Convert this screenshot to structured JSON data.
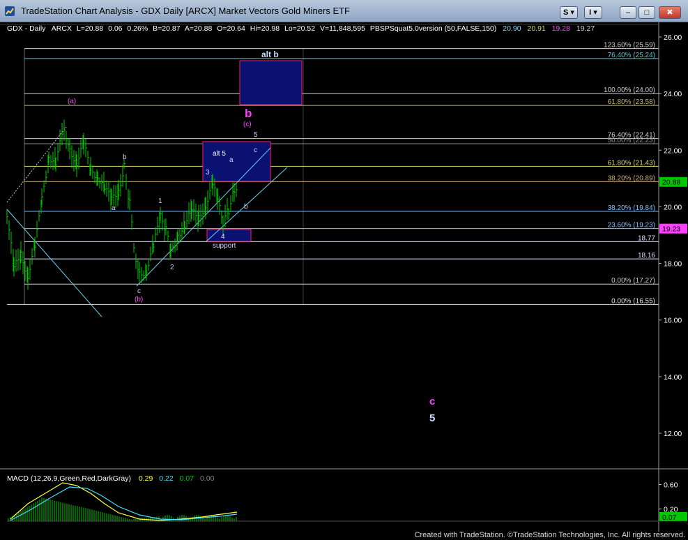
{
  "window": {
    "title": "TradeStation Chart Analysis - GDX Daily [ARCX] Market Vectors Gold Miners ETF",
    "btn_s": "S",
    "btn_i": "I",
    "btn_minimize": "–",
    "btn_restore": "□",
    "btn_close": "✖"
  },
  "status_line": {
    "symbol": "GDX - Daily",
    "exchange": "ARCX",
    "last": "L=20.88",
    "change": "0.06",
    "pct": "0.26%",
    "bid": "B=20.87",
    "ask": "A=20.88",
    "open": "O=20.64",
    "high": "Hi=20.98",
    "low": "Lo=20.52",
    "volume": "V=11,848,595",
    "study": "PBSPSquat5.0version (50,FALSE,150)",
    "v1": "20.90",
    "v2": "20.91",
    "v3": "19.28",
    "v4": "19.27"
  },
  "colors": {
    "study_v1": "#7fd7ff",
    "study_v2": "#d7d76c",
    "study_v3": "#ff40ff",
    "study_v4": "#d7d7d7",
    "price_bars": "#00c800",
    "box_fill": "#0a1170",
    "box_border": "#ff1a6b",
    "wave_magenta": "#ff40ff",
    "wave_white": "#c8c8ff",
    "channel_line": "#6ed0f0",
    "last_price_bg": "#00c800",
    "support_price_bg": "#ff40ff"
  },
  "price_axis": {
    "min": 11,
    "max": 26.5,
    "ticks": [
      "26.00",
      "24.00",
      "22.00",
      "20.00",
      "18.00",
      "16.00",
      "14.00",
      "12.00"
    ],
    "last_price": "20.88",
    "last_value": 20.88,
    "support_price": "19.23",
    "support_value": 19.23
  },
  "fib_levels": [
    {
      "label": "123.60% (25.59)",
      "value": 25.59,
      "color": "#d0d0d0"
    },
    {
      "label": "76.40% (25.24)",
      "value": 25.24,
      "color": "#56c8d0"
    },
    {
      "label": "100.00% (24.00)",
      "value": 24.0,
      "color": "#d0d0d0"
    },
    {
      "label": "61.80% (23.58)",
      "value": 23.58,
      "color": "#c8b070"
    },
    {
      "label": "76.40% (22.41)",
      "value": 22.41,
      "color": "#d0d0d0"
    },
    {
      "label": "50.00% (22.23)",
      "value": 22.23,
      "color": "#909090"
    },
    {
      "label": "61.80% (21.43)",
      "value": 21.43,
      "color": "#d7d76c"
    },
    {
      "label": "38.20% (20.89)",
      "value": 20.89,
      "color": "#c8b070"
    },
    {
      "label": "38.20% (19.84)",
      "value": 19.84,
      "color": "#7fc4ff"
    },
    {
      "label": "23.60% (19.23)",
      "value": 19.23,
      "color": "#7fc4ff"
    },
    {
      "label": "18.77",
      "value": 18.77,
      "color": "#e0e0ff"
    },
    {
      "label": "18.16",
      "value": 18.16,
      "color": "#e0e0ff"
    },
    {
      "label": "0.00% (17.27)",
      "value": 17.27,
      "color": "#d0d0d0"
    },
    {
      "label": "0.00% (16.55)",
      "value": 16.55,
      "color": "#e0e0e0"
    }
  ],
  "wave_labels": {
    "alt_b": "alt b",
    "b_big": "b",
    "c_paren": "(c)",
    "five_top": "5",
    "alt_five": "alt 5",
    "c_small": "c",
    "a_small": "a",
    "three": "3",
    "a_paren": "(a)",
    "b_left": "b",
    "a_left": "a",
    "one": "1",
    "two": "2",
    "four": "4",
    "support": "support",
    "b_right": "b",
    "c_bottom": "c",
    "b_paren": "(b)",
    "c_big": "c",
    "five_big": "5"
  },
  "macd": {
    "label": "MACD (12,26,9,Green,Red,DarkGray)",
    "v1": "0.29",
    "v2": "0.22",
    "v3": "0.07",
    "v4": "0.00",
    "axis_min": 0.0,
    "axis_max": 0.8,
    "ticks": [
      "0.60",
      "0.20"
    ],
    "current": "0.07",
    "current_value": 0.07,
    "colors": {
      "v1": "#ffff40",
      "v2": "#40e0ff",
      "v3": "#00c800",
      "v4": "#808080"
    }
  },
  "footer": "Created with TradeStation. ©TradeStation Technologies, Inc. All rights reserved."
}
